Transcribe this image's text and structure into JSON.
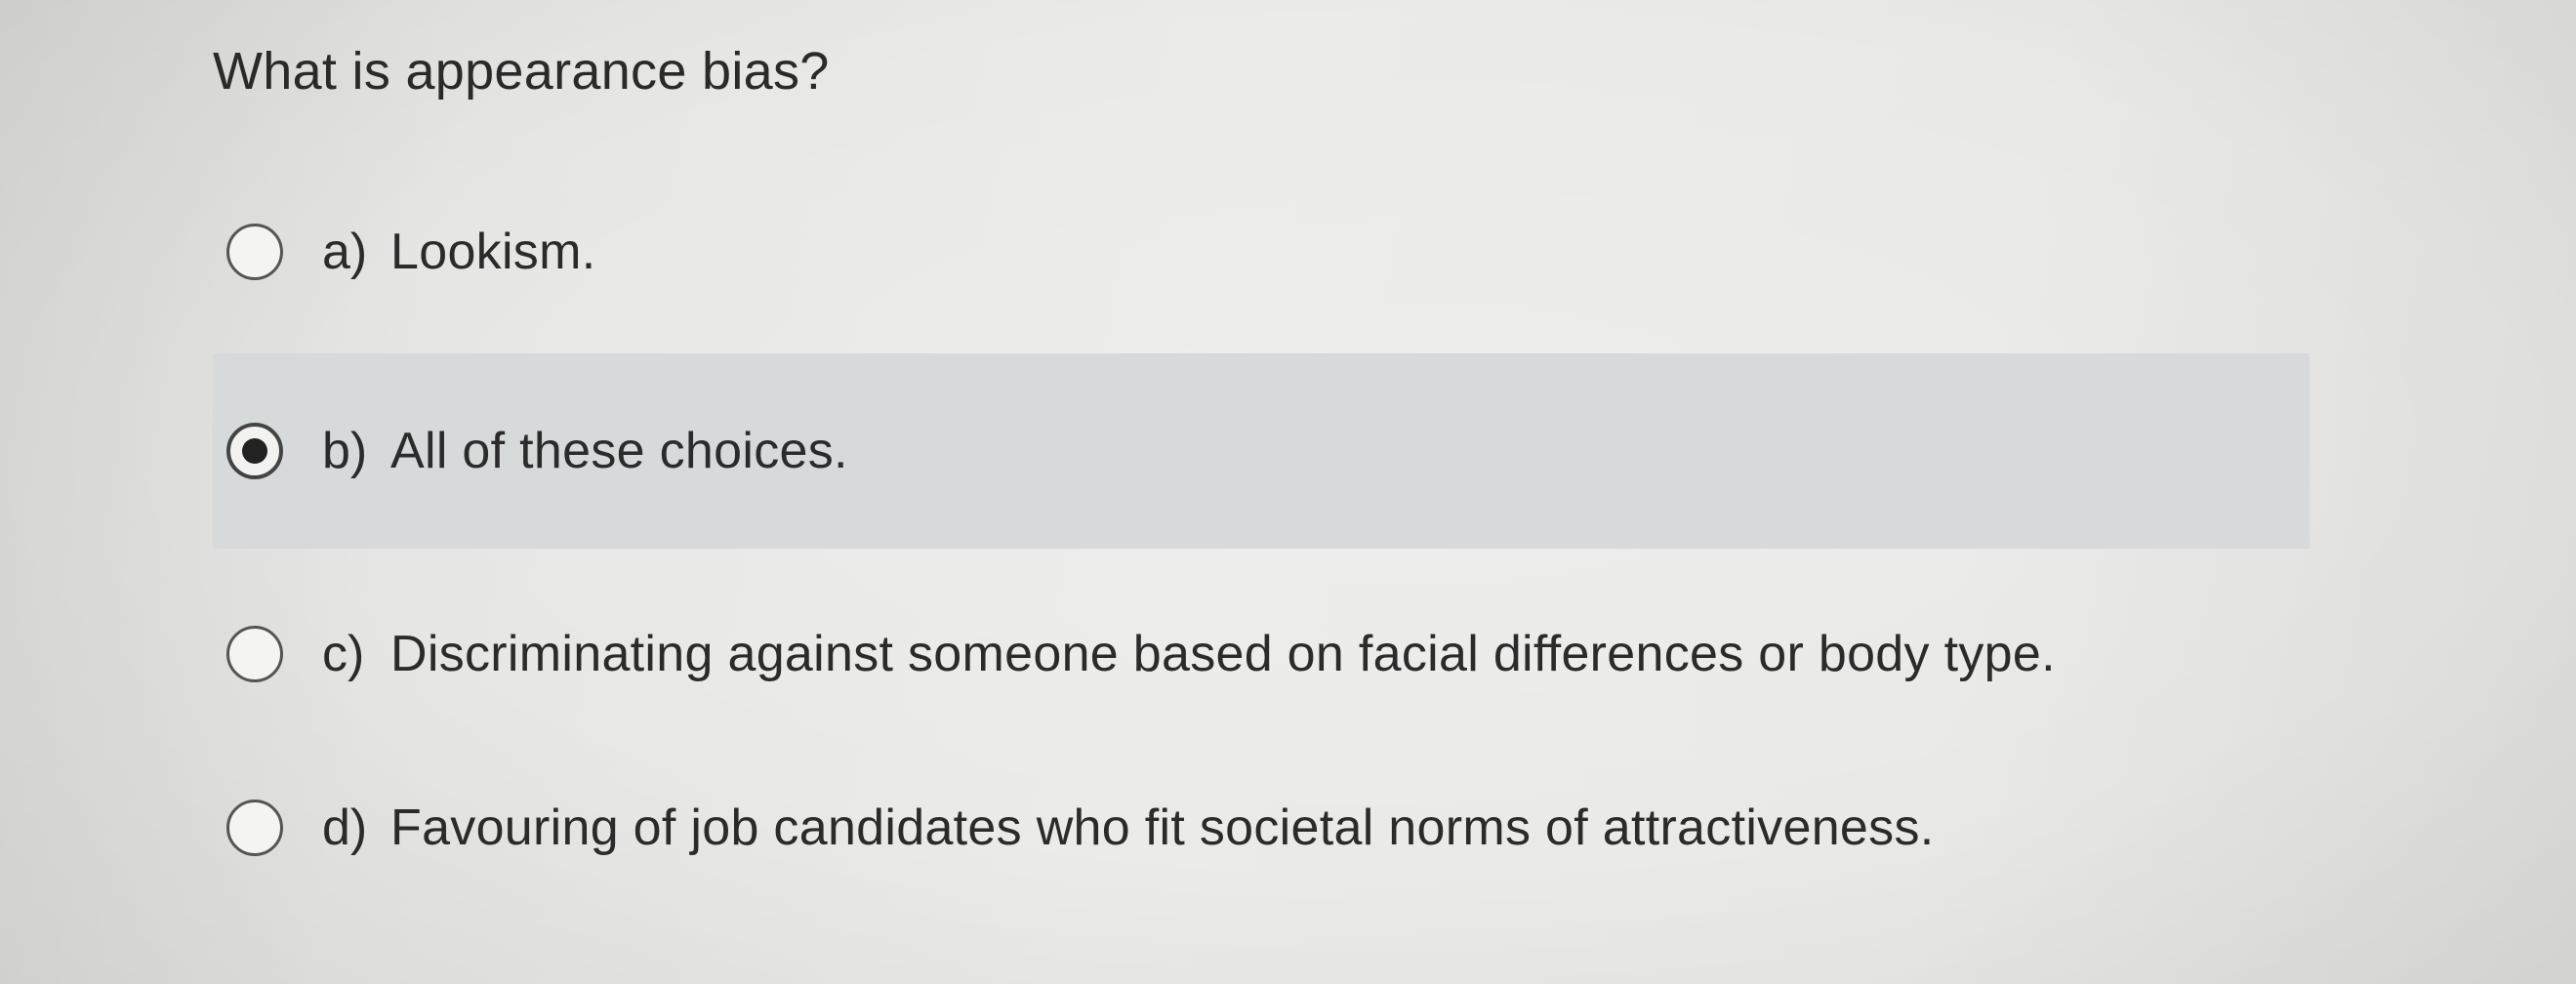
{
  "question": {
    "text": "What is appearance bias?"
  },
  "options": [
    {
      "letter": "a)",
      "text": "Lookism.",
      "selected": false
    },
    {
      "letter": "b)",
      "text": "All of these choices.",
      "selected": true
    },
    {
      "letter": "c)",
      "text": "Discriminating against someone based on facial differences or body type.",
      "selected": false
    },
    {
      "letter": "d)",
      "text": "Favouring of job candidates who fit societal norms of attractiveness.",
      "selected": false
    }
  ],
  "colors": {
    "background": "#e9e9e7",
    "selected_row": "#d6dadb",
    "text": "#2b2b2b"
  }
}
